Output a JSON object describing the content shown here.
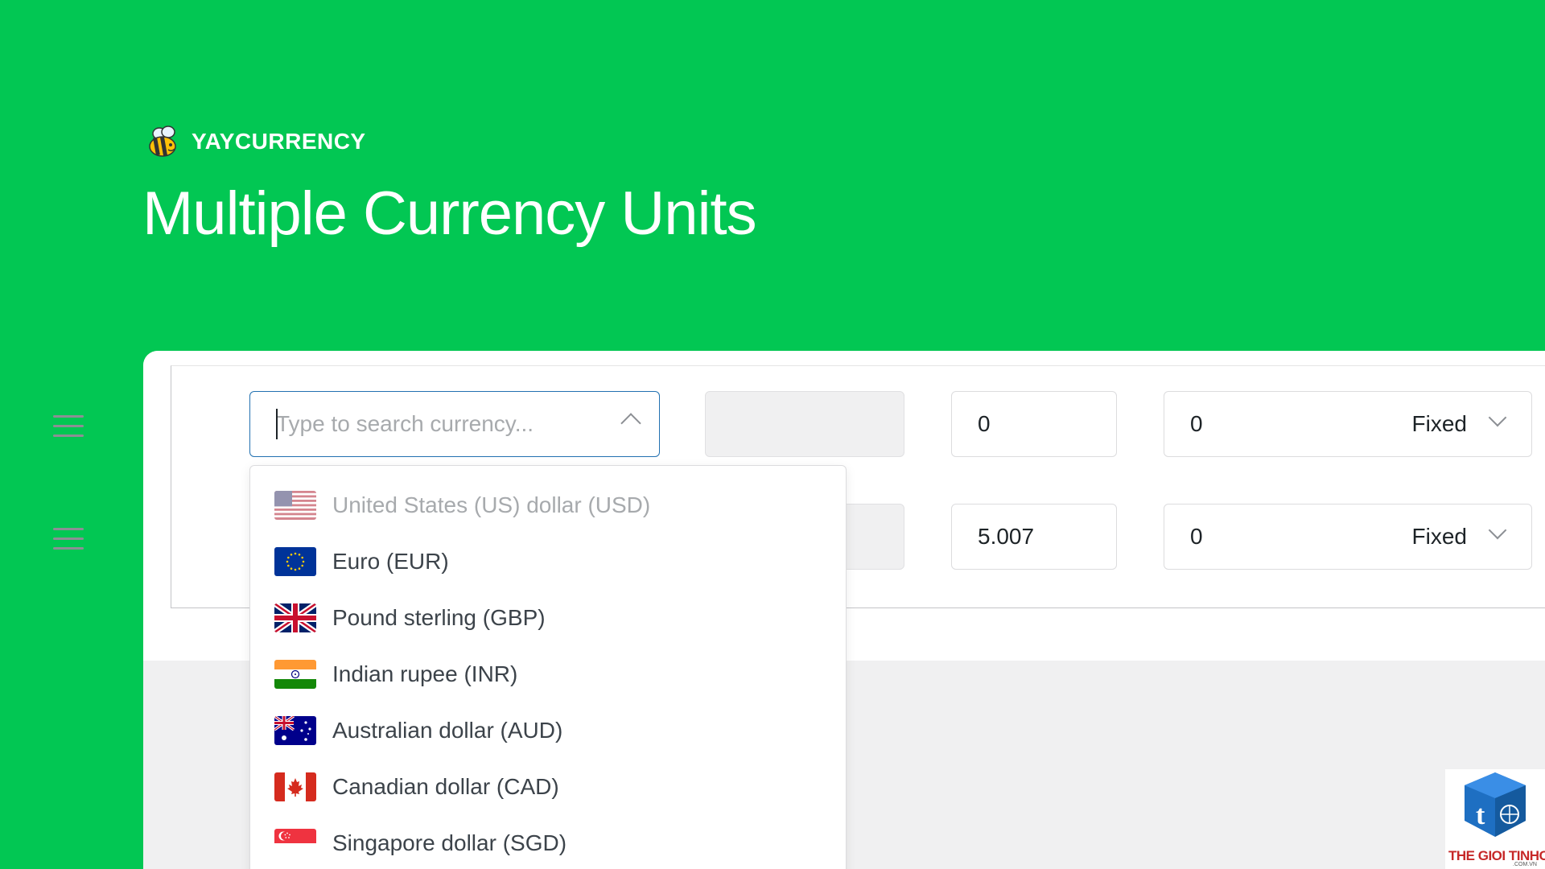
{
  "brand": {
    "name": "YAYCURRENCY"
  },
  "headline": "Multiple Currency Units",
  "search": {
    "placeholder": "Type to search currency..."
  },
  "rows": [
    {
      "rate": "0",
      "fee_value": "0",
      "fee_type": "Fixed"
    },
    {
      "rate": "5.007",
      "fee_value": "0",
      "fee_type": "Fixed"
    }
  ],
  "currency_options": [
    {
      "label": "United States (US) dollar (USD)",
      "flag": "us-flag-icon",
      "disabled": true
    },
    {
      "label": "Euro (EUR)",
      "flag": "eu-flag-icon"
    },
    {
      "label": "Pound sterling (GBP)",
      "flag": "gb-flag-icon"
    },
    {
      "label": "Indian rupee (INR)",
      "flag": "in-flag-icon"
    },
    {
      "label": "Australian dollar (AUD)",
      "flag": "au-flag-icon"
    },
    {
      "label": "Canadian dollar (CAD)",
      "flag": "ca-flag-icon"
    },
    {
      "label": "Singapore dollar (SGD)",
      "flag": "sg-flag-icon"
    }
  ],
  "watermark": {
    "text": "THE GIOI TINHOC",
    "sub": ".COM.VN"
  },
  "colors": {
    "background": "#02c753",
    "accent": "#2271b1"
  }
}
